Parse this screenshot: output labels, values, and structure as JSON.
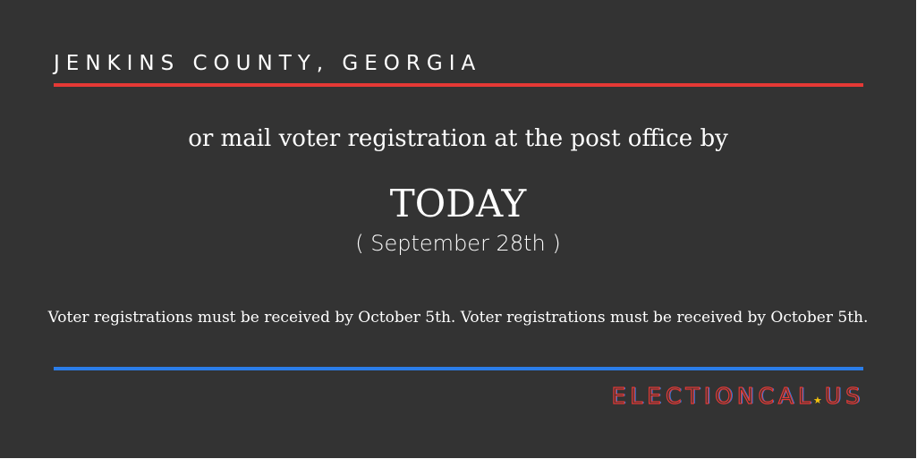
{
  "header": {
    "location": "JENKINS COUNTY, GEORGIA"
  },
  "message": {
    "intro": "or mail voter registration at the post office by",
    "deadline": "TODAY",
    "date": "( September 28th )",
    "notice": "Voter registrations must be received by October 5th. Voter registrations must be received by October 5th."
  },
  "brand": {
    "part1": "ELECTIONCAL",
    "star": "★",
    "part2": "US"
  },
  "colors": {
    "background": "#333333",
    "accent_red": "#e53935",
    "accent_blue": "#2b7de9",
    "star": "#f4c20d"
  }
}
